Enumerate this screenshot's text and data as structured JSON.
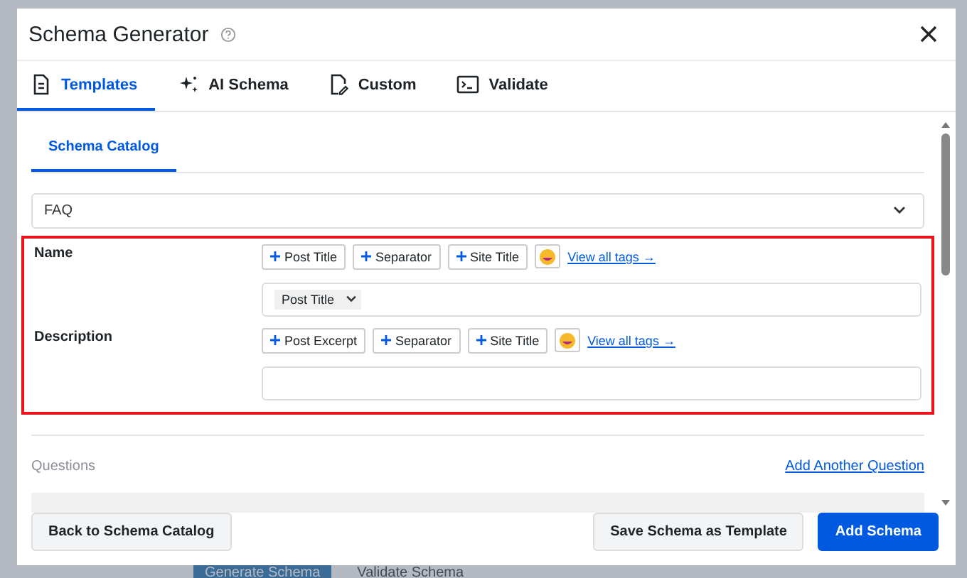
{
  "background": {
    "buttons": [
      "Generate Schema",
      "Validate Schema"
    ]
  },
  "dialog": {
    "title": "Schema Generator",
    "tabs": [
      {
        "label": "Templates",
        "selected": true
      },
      {
        "label": "AI Schema",
        "selected": false
      },
      {
        "label": "Custom",
        "selected": false
      },
      {
        "label": "Validate",
        "selected": false
      }
    ],
    "subtabs": [
      {
        "label": "Schema Catalog",
        "selected": true
      }
    ],
    "schema_type": "FAQ",
    "fields_highlighted": true,
    "fields": [
      {
        "label": "Name",
        "tags": [
          "Post Title",
          "Separator",
          "Site Title"
        ],
        "link": "View all tags →",
        "chips": [
          "Post Title"
        ]
      },
      {
        "label": "Description",
        "tags": [
          "Post Excerpt",
          "Separator",
          "Site Title"
        ],
        "link": "View all tags →"
      }
    ],
    "questions": {
      "label": "Questions",
      "link": "Add Another Question"
    },
    "footer": {
      "back": "Back to Schema Catalog",
      "save_template": "Save Schema as Template",
      "add": "Add Schema"
    }
  }
}
